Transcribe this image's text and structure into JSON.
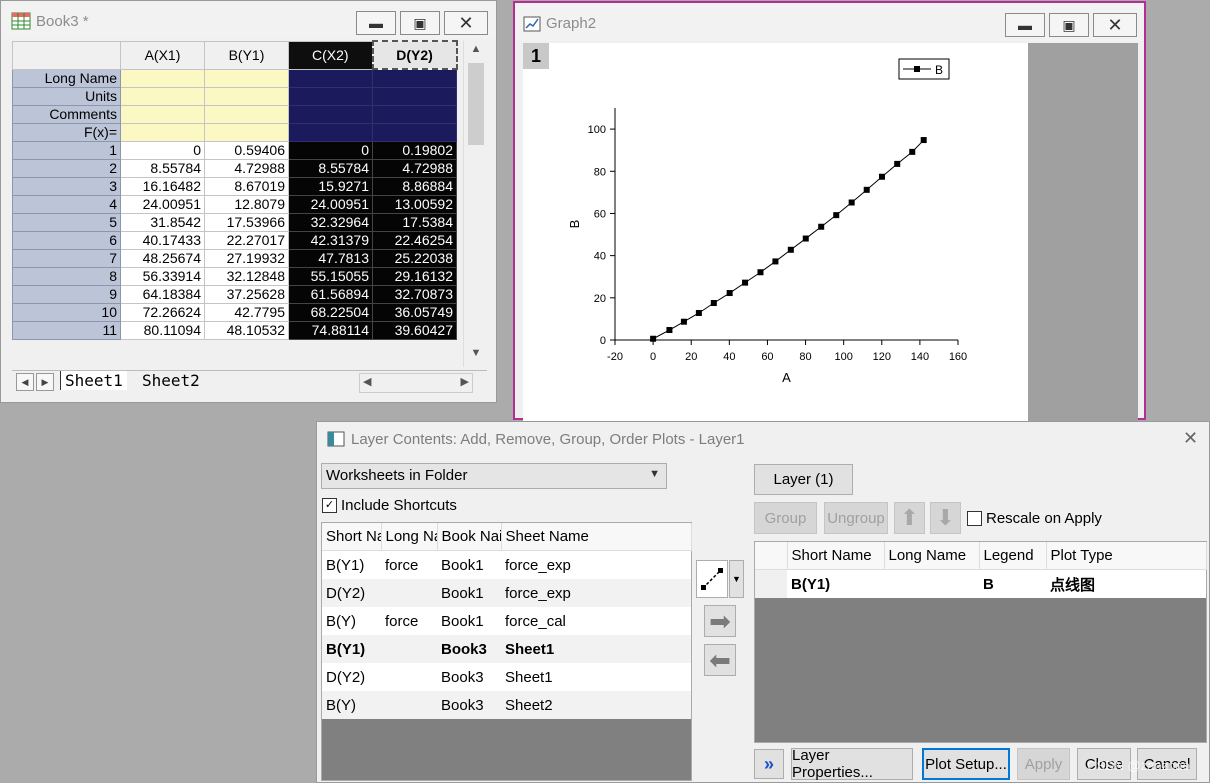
{
  "book_window": {
    "title": "Book3 *",
    "columns": [
      "A(X1)",
      "B(Y1)",
      "C(X2)",
      "D(Y2)"
    ],
    "label_rows": [
      "Long Name",
      "Units",
      "Comments",
      "F(x)="
    ],
    "rows": [
      {
        "n": "1",
        "a": "0",
        "b": "0.59406",
        "c": "0",
        "d": "0.19802"
      },
      {
        "n": "2",
        "a": "8.55784",
        "b": "4.72988",
        "c": "8.55784",
        "d": "4.72988"
      },
      {
        "n": "3",
        "a": "16.16482",
        "b": "8.67019",
        "c": "15.9271",
        "d": "8.86884"
      },
      {
        "n": "4",
        "a": "24.00951",
        "b": "12.8079",
        "c": "24.00951",
        "d": "13.00592"
      },
      {
        "n": "5",
        "a": "31.8542",
        "b": "17.53966",
        "c": "32.32964",
        "d": "17.5384"
      },
      {
        "n": "6",
        "a": "40.17433",
        "b": "22.27017",
        "c": "42.31379",
        "d": "22.46254"
      },
      {
        "n": "7",
        "a": "48.25674",
        "b": "27.19932",
        "c": "47.7813",
        "d": "25.22038"
      },
      {
        "n": "8",
        "a": "56.33914",
        "b": "32.12848",
        "c": "55.15055",
        "d": "29.16132"
      },
      {
        "n": "9",
        "a": "64.18384",
        "b": "37.25628",
        "c": "61.56894",
        "d": "32.70873"
      },
      {
        "n": "10",
        "a": "72.26624",
        "b": "42.7795",
        "c": "68.22504",
        "d": "36.05749"
      },
      {
        "n": "11",
        "a": "80.11094",
        "b": "48.10532",
        "c": "74.88114",
        "d": "39.60427"
      }
    ],
    "sheets": [
      "Sheet1",
      "Sheet2"
    ]
  },
  "graph_window": {
    "title": "Graph2",
    "layer_number": "1",
    "chart_data": {
      "type": "line",
      "xlabel": "A",
      "ylabel": "B",
      "xlim": [
        -20,
        160
      ],
      "ylim": [
        0,
        110
      ],
      "x_ticks": [
        "-20",
        "0",
        "20",
        "40",
        "60",
        "80",
        "100",
        "120",
        "140",
        "160"
      ],
      "y_ticks": [
        "0",
        "20",
        "40",
        "60",
        "80",
        "100"
      ],
      "legend": {
        "label": "B",
        "position": "top-right"
      },
      "series": [
        {
          "name": "B",
          "marker": "square",
          "x": [
            0,
            8.55784,
            16.16482,
            24.00951,
            31.8542,
            40.17433,
            48.25674,
            56.33914,
            64.18384,
            72.26624,
            80.11094,
            88.2,
            96.1,
            104.2,
            112.1,
            120.1,
            128.1,
            136.0,
            142.0
          ],
          "y": [
            0.59406,
            4.72988,
            8.67019,
            12.8079,
            17.53966,
            22.27017,
            27.19932,
            32.12848,
            37.25628,
            42.7795,
            48.10532,
            53.7,
            59.2,
            65.2,
            71.2,
            77.4,
            83.5,
            89.2,
            94.8
          ]
        }
      ]
    }
  },
  "dialog": {
    "title": "Layer Contents: Add, Remove, Group, Order Plots - Layer1",
    "source_combo": "Worksheets in Folder",
    "include_shortcuts": "Include Shortcuts",
    "left_columns": [
      "Short Na",
      "Long Na",
      "Book Nai",
      "Sheet Name"
    ],
    "left_rows": [
      {
        "short": "B(Y1)",
        "long": "force",
        "book": "Book1",
        "sheet": "force_exp"
      },
      {
        "short": "D(Y2)",
        "long": "",
        "book": "Book1",
        "sheet": "force_exp"
      },
      {
        "short": "B(Y)",
        "long": "force",
        "book": "Book1",
        "sheet": "force_cal"
      },
      {
        "short": "B(Y1)",
        "long": "",
        "book": "Book3",
        "sheet": "Sheet1"
      },
      {
        "short": "D(Y2)",
        "long": "",
        "book": "Book3",
        "sheet": "Sheet1"
      },
      {
        "short": "B(Y)",
        "long": "",
        "book": "Book3",
        "sheet": "Sheet2"
      }
    ],
    "layer_button": "Layer (1)",
    "group_button": "Group",
    "ungroup_button": "Ungroup",
    "rescale_label": "Rescale on Apply",
    "right_columns": [
      "Short Name",
      "Long Name",
      "Legend",
      "Plot Type"
    ],
    "right_rows": [
      {
        "short": "B(Y1)",
        "long": "",
        "legend": "B",
        "type": "点线图"
      }
    ],
    "expand_button": "»",
    "layer_properties_button": "Layer Properties...",
    "plot_setup_button": "Plot Setup...",
    "apply_button": "Apply",
    "close_button": "Close",
    "cancel_button": "Cancel",
    "watermark": "CSDN @zaoznao"
  }
}
